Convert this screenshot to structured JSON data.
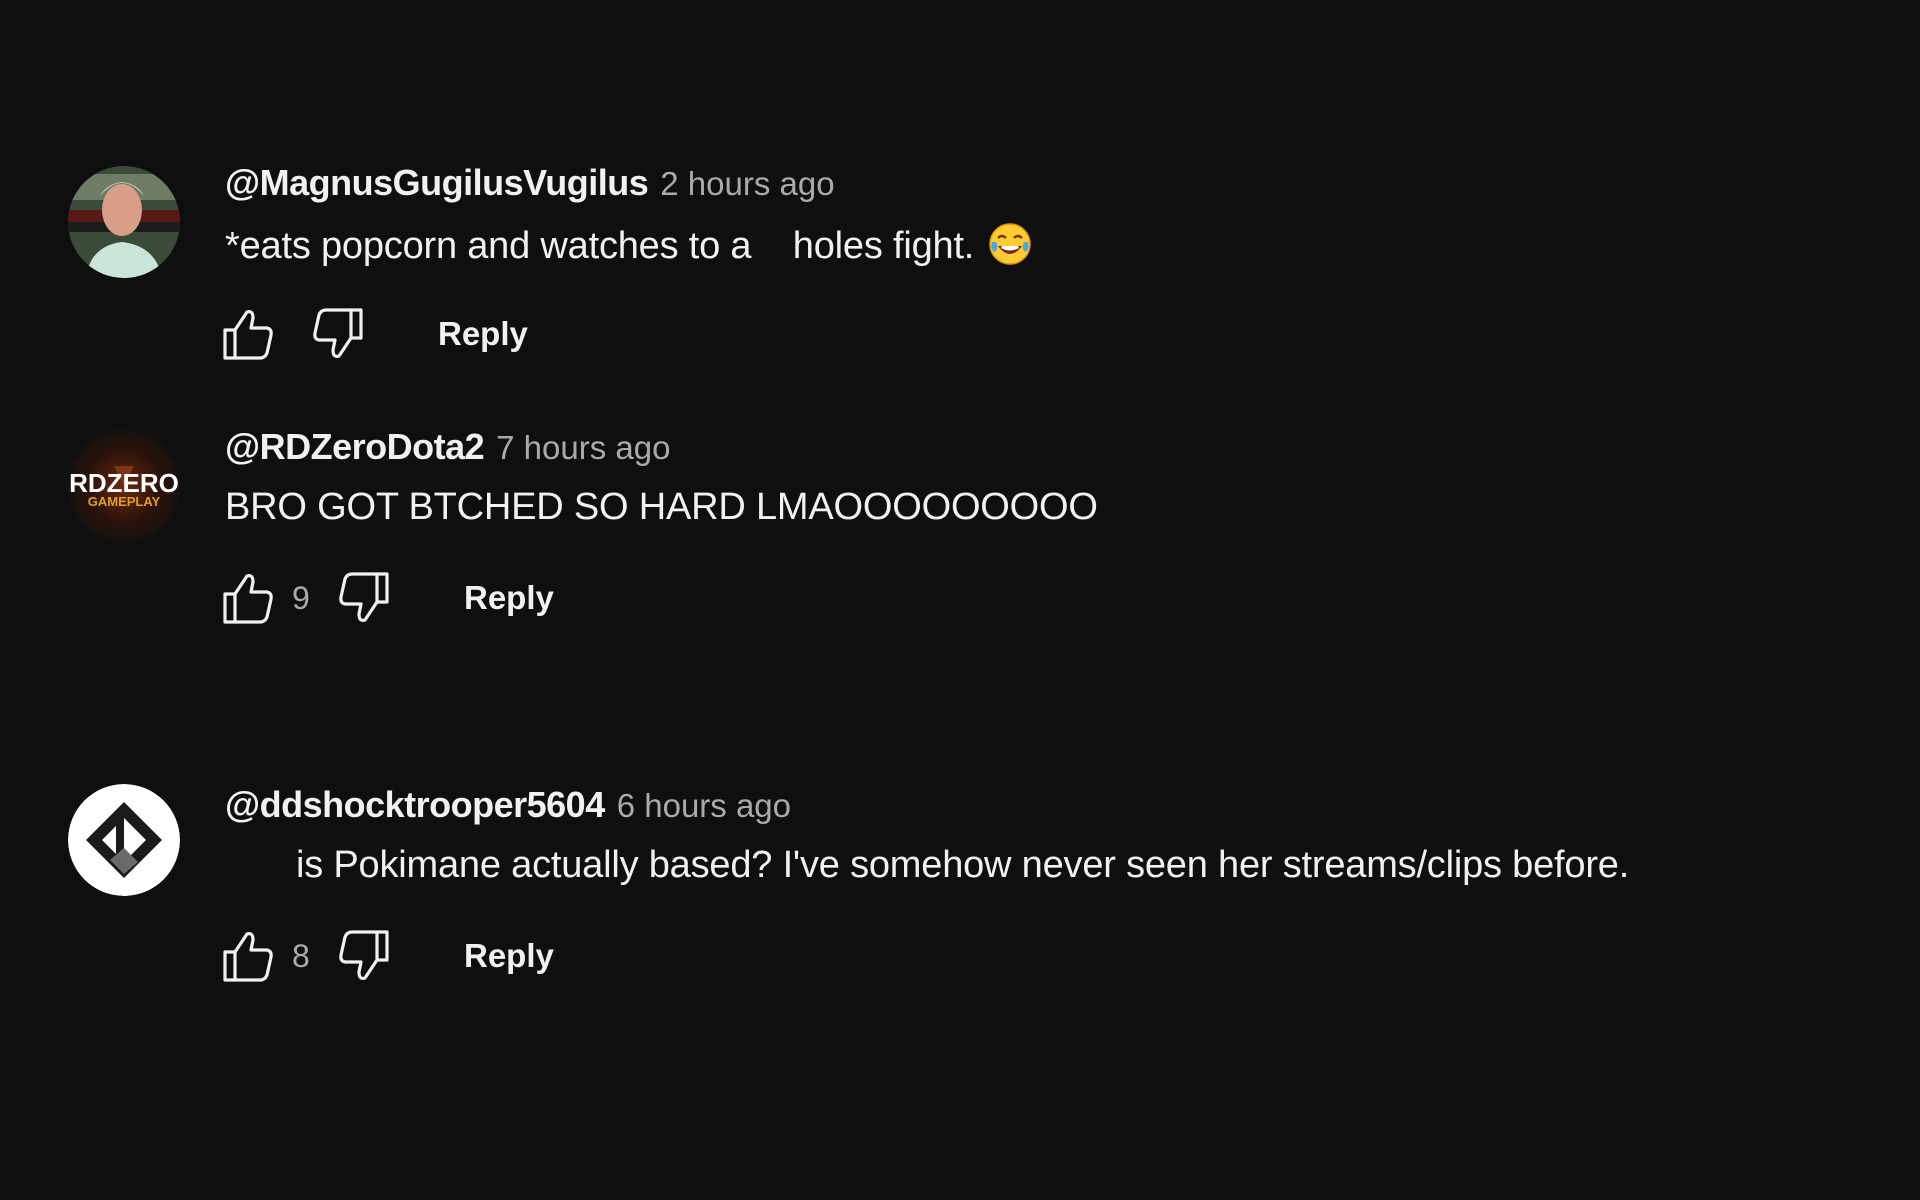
{
  "comments": [
    {
      "author": "@MagnusGugilusVugilus",
      "time": "2 hours ago",
      "text": "*eats popcorn and watches to a    holes fight.",
      "emoji": "😂",
      "likes": "",
      "reply_label": "Reply",
      "avatar_icon": "user-photo-avatar"
    },
    {
      "author": "@RDZeroDota2",
      "time": "7 hours ago",
      "text": "BRO GOT BTCHED SO HARD LMAOOOOOOOOO",
      "likes": "9",
      "reply_label": "Reply",
      "avatar_icon": "rdzero-logo-avatar",
      "avatar_logo_text": "RDZERO",
      "avatar_logo_subtext": "GAMEPLAY"
    },
    {
      "author": "@ddshocktrooper5604",
      "time": "6 hours ago",
      "text": "is Pokimane actually based? I've somehow never seen her streams/clips before.",
      "likes": "8",
      "reply_label": "Reply",
      "avatar_icon": "diamond-logo-avatar"
    }
  ],
  "colors": {
    "background": "#0f0f0f",
    "primary_text": "#f1f1f1",
    "secondary_text": "#aaaaaa"
  }
}
